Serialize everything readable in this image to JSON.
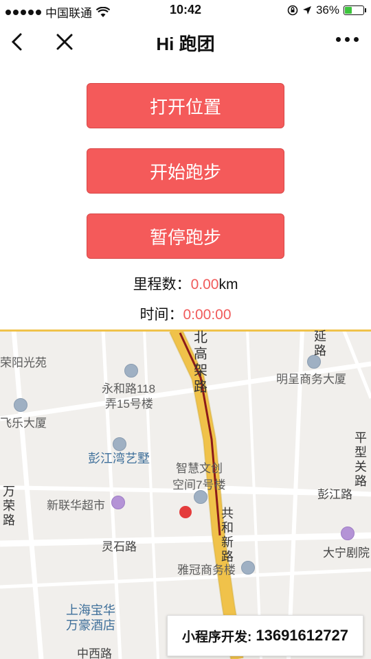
{
  "status_bar": {
    "carrier": "中国联通",
    "time": "10:42",
    "battery": "36%",
    "battery_level": 0.36
  },
  "nav": {
    "title": "Hi 跑团"
  },
  "buttons": {
    "open_location": "打开位置",
    "start_run": "开始跑步",
    "pause_run": "暂停跑步"
  },
  "stats": {
    "distance_label": "里程数：",
    "distance_value": "0.00",
    "distance_unit": "km",
    "time_label": "时间：",
    "time_value": "0:00:00"
  },
  "map": {
    "labels": {
      "rongyang": "荣阳光苑",
      "yonghe": "永和路118",
      "yonghe2": "弄15号楼",
      "feile": "飞乐大厦",
      "pengjiang_villa": "彭江湾艺墅",
      "smart": "智慧文创",
      "smart2": "空间7号楼",
      "xinlianhua": "新联华超市",
      "lingshi": "灵石路",
      "yaguan": "雅冠商务楼",
      "shanghai_baohua": "上海宝华",
      "wanhao": "万豪酒店",
      "zhongxi": "中西路",
      "mingcheng": "明呈商务大厦",
      "pengjiang_road": "彭江路",
      "daning": "大宁剧院",
      "north_elevated": "北高架路",
      "gonghe": "共和新路",
      "wanrong": "万荣路",
      "yan": "延路",
      "pingxing": "平型关路"
    }
  },
  "dev_banner": {
    "label": "小程序开发:",
    "phone": "13691612727"
  },
  "colors": {
    "accent": "#f45a5a",
    "stat_value": "#f05a5a",
    "battery": "#3cc43c",
    "location_dot": "#e43c3c"
  }
}
